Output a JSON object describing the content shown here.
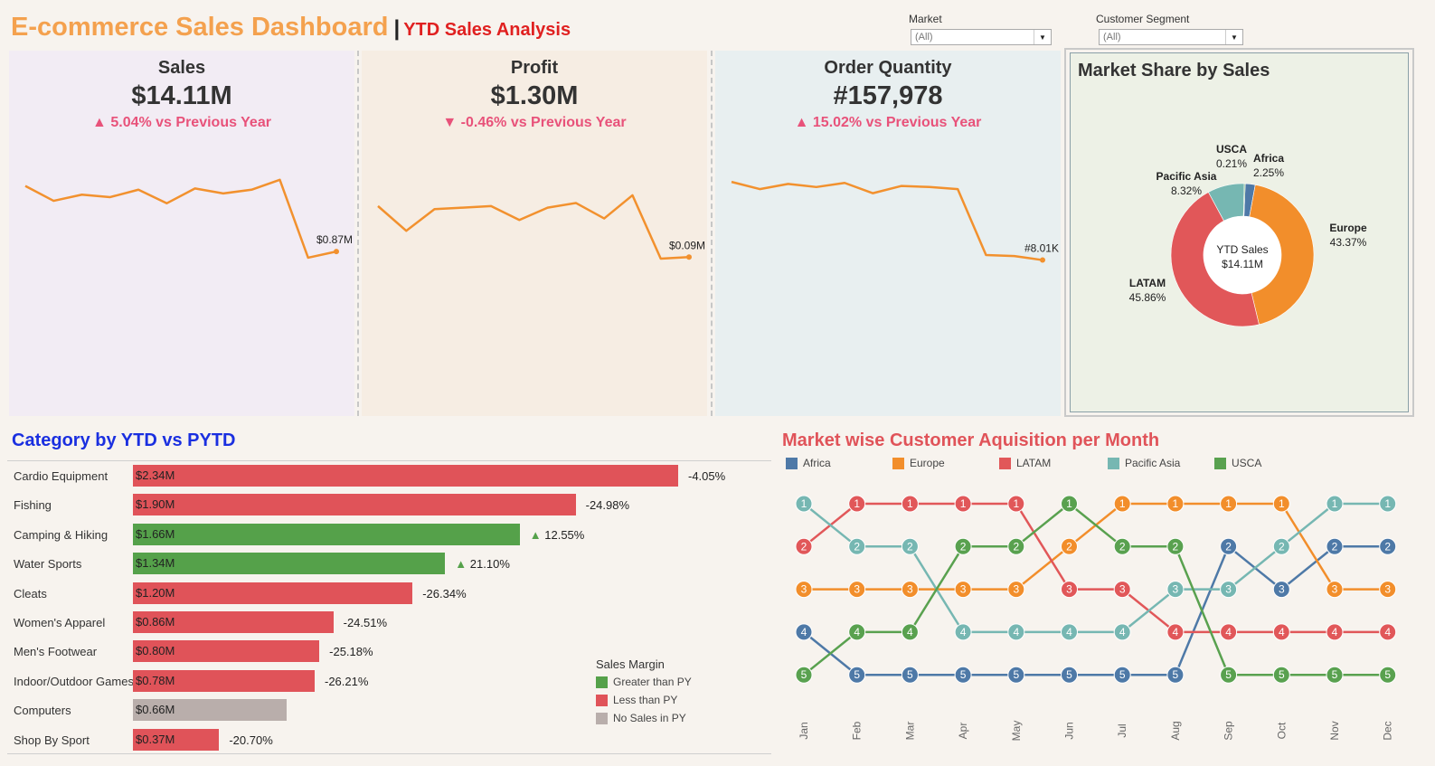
{
  "header": {
    "title": "E-commerce Sales Dashboard",
    "separator": "|",
    "subtitle": "YTD Sales Analysis"
  },
  "filters": {
    "market": {
      "label": "Market",
      "value": "(All)"
    },
    "segment": {
      "label": "Customer Segment",
      "value": "(All)"
    }
  },
  "colors": {
    "accent_orange": "#f4a14e",
    "line_orange": "#f2912e",
    "positive_green": "#55a14a",
    "negative_red": "#e05359",
    "neutral_gray": "#b9aeab",
    "kpi_change_pink": "#e8527a",
    "category_title_blue": "#1a2fe0",
    "acquisition_title_red": "#e05359"
  },
  "kpis": [
    {
      "title": "Sales",
      "value": "$14.11M",
      "arrow": "▲",
      "change": "5.04% vs Previous Year",
      "end_label": "$0.87M",
      "chart_data": {
        "type": "line",
        "values": [
          1.4,
          1.28,
          1.33,
          1.31,
          1.37,
          1.26,
          1.38,
          1.34,
          1.37,
          1.45,
          0.82,
          0.87
        ],
        "ylim": [
          0.3,
          1.8
        ]
      }
    },
    {
      "title": "Profit",
      "value": "$1.30M",
      "arrow": "▼",
      "change": "-0.46% vs Previous Year",
      "end_label": "$0.09M",
      "chart_data": {
        "type": "line",
        "values": [
          0.125,
          0.109,
          0.123,
          0.124,
          0.125,
          0.116,
          0.124,
          0.127,
          0.117,
          0.132,
          0.091,
          0.092
        ],
        "ylim": [
          0.05,
          0.17
        ]
      }
    },
    {
      "title": "Order Quantity",
      "value": "#157,978",
      "arrow": "▲",
      "change": "15.02% vs Previous Year",
      "end_label": "#8.01K",
      "chart_data": {
        "type": "line",
        "values": [
          15.6,
          14.9,
          15.4,
          15.1,
          15.5,
          14.5,
          15.2,
          15.1,
          14.9,
          8.5,
          8.4,
          8.01
        ],
        "ylim": [
          2,
          20
        ]
      }
    }
  ],
  "market_share": {
    "title": "Market Share by Sales",
    "center_label_1": "YTD Sales",
    "center_label_2": "$14.11M",
    "chart_data": {
      "type": "pie",
      "slices": [
        {
          "name": "Africa",
          "value": 2.25,
          "label": "2.25%",
          "color": "#4e79a7"
        },
        {
          "name": "Europe",
          "value": 43.37,
          "label": "43.37%",
          "color": "#f28e2b"
        },
        {
          "name": "LATAM",
          "value": 45.86,
          "label": "45.86%",
          "color": "#e15759"
        },
        {
          "name": "Pacific Asia",
          "value": 8.32,
          "label": "8.32%",
          "color": "#76b7b2"
        },
        {
          "name": "USCA",
          "value": 0.21,
          "label": "0.21%",
          "color": "#59a14f"
        }
      ]
    }
  },
  "category": {
    "title": "Category by YTD vs PYTD",
    "chart_data": {
      "type": "bar",
      "max": 2.34,
      "rows": [
        {
          "name": "Cardio Equipment",
          "value": 2.34,
          "label": "$2.34M",
          "status": "less",
          "arrow": "",
          "pct": "-4.05%"
        },
        {
          "name": "Fishing",
          "value": 1.9,
          "label": "$1.90M",
          "status": "less",
          "arrow": "",
          "pct": "-24.98%"
        },
        {
          "name": "Camping & Hiking",
          "value": 1.66,
          "label": "$1.66M",
          "status": "greater",
          "arrow": "▲",
          "pct": "12.55%"
        },
        {
          "name": "Water Sports",
          "value": 1.34,
          "label": "$1.34M",
          "status": "greater",
          "arrow": "▲",
          "pct": "21.10%"
        },
        {
          "name": "Cleats",
          "value": 1.2,
          "label": "$1.20M",
          "status": "less",
          "arrow": "",
          "pct": "-26.34%"
        },
        {
          "name": "Women's Apparel",
          "value": 0.86,
          "label": "$0.86M",
          "status": "less",
          "arrow": "",
          "pct": "-24.51%"
        },
        {
          "name": "Men's Footwear",
          "value": 0.8,
          "label": "$0.80M",
          "status": "less",
          "arrow": "",
          "pct": "-25.18%"
        },
        {
          "name": "Indoor/Outdoor Games",
          "value": 0.78,
          "label": "$0.78M",
          "status": "less",
          "arrow": "",
          "pct": "-26.21%"
        },
        {
          "name": "Computers",
          "value": 0.66,
          "label": "$0.66M",
          "status": "none",
          "arrow": "",
          "pct": ""
        },
        {
          "name": "Shop By Sport",
          "value": 0.37,
          "label": "$0.37M",
          "status": "less",
          "arrow": "",
          "pct": "-20.70%"
        }
      ]
    },
    "legend": {
      "title": "Sales Margin",
      "items": [
        {
          "label": "Greater than PY",
          "color": "#55a14a"
        },
        {
          "label": "Less than PY",
          "color": "#e05359"
        },
        {
          "label": "No Sales in PY",
          "color": "#b9aeab"
        }
      ]
    }
  },
  "acquisition": {
    "title": "Market wise Customer Aquisition per Month",
    "chart_data": {
      "type": "line",
      "x": [
        "Jan",
        "Feb",
        "Mar",
        "Apr",
        "May",
        "Jun",
        "Jul",
        "Aug",
        "Sep",
        "Oct",
        "Nov",
        "Dec"
      ],
      "series": [
        {
          "name": "Africa",
          "color": "#4e79a7",
          "ranks": [
            4,
            5,
            5,
            5,
            5,
            5,
            5,
            5,
            2,
            3,
            2,
            2
          ]
        },
        {
          "name": "Europe",
          "color": "#f28e2b",
          "ranks": [
            3,
            3,
            3,
            3,
            3,
            2,
            1,
            1,
            1,
            1,
            3,
            3
          ]
        },
        {
          "name": "LATAM",
          "color": "#e15759",
          "ranks": [
            2,
            1,
            1,
            1,
            1,
            3,
            3,
            4,
            4,
            4,
            4,
            4
          ]
        },
        {
          "name": "Pacific Asia",
          "color": "#76b7b2",
          "ranks": [
            1,
            2,
            2,
            4,
            4,
            4,
            4,
            3,
            3,
            2,
            1,
            1
          ]
        },
        {
          "name": "USCA",
          "color": "#59a14f",
          "ranks": [
            5,
            4,
            4,
            2,
            2,
            1,
            2,
            2,
            5,
            5,
            5,
            5
          ]
        }
      ]
    }
  }
}
